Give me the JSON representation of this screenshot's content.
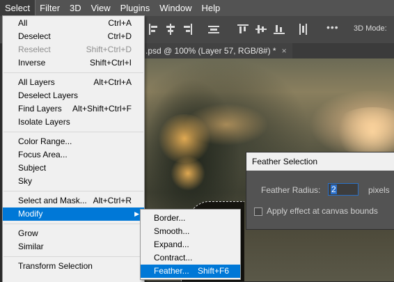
{
  "menubar": {
    "items": [
      "Select",
      "Filter",
      "3D",
      "View",
      "Plugins",
      "Window",
      "Help"
    ],
    "active": "Select"
  },
  "options_bar": {
    "mode_label": "3D Mode:",
    "more_label": "•••"
  },
  "document_tab": {
    "title": ".psd @ 100% (Layer 57, RGB/8#) *",
    "close_glyph": "×"
  },
  "select_menu": {
    "groups": [
      [
        {
          "label": "All",
          "shortcut": "Ctrl+A"
        },
        {
          "label": "Deselect",
          "shortcut": "Ctrl+D"
        },
        {
          "label": "Reselect",
          "shortcut": "Shift+Ctrl+D",
          "disabled": true
        },
        {
          "label": "Inverse",
          "shortcut": "Shift+Ctrl+I"
        }
      ],
      [
        {
          "label": "All Layers",
          "shortcut": "Alt+Ctrl+A"
        },
        {
          "label": "Deselect Layers",
          "shortcut": ""
        },
        {
          "label": "Find Layers",
          "shortcut": "Alt+Shift+Ctrl+F"
        },
        {
          "label": "Isolate Layers",
          "shortcut": ""
        }
      ],
      [
        {
          "label": "Color Range...",
          "shortcut": ""
        },
        {
          "label": "Focus Area...",
          "shortcut": ""
        },
        {
          "label": "Subject",
          "shortcut": ""
        },
        {
          "label": "Sky",
          "shortcut": ""
        }
      ],
      [
        {
          "label": "Select and Mask...",
          "shortcut": "Alt+Ctrl+R"
        },
        {
          "label": "Modify",
          "shortcut": "",
          "submenu": true,
          "highlighted": true
        }
      ],
      [
        {
          "label": "Grow",
          "shortcut": ""
        },
        {
          "label": "Similar",
          "shortcut": ""
        }
      ],
      [
        {
          "label": "Transform Selection",
          "shortcut": ""
        }
      ]
    ]
  },
  "modify_submenu": {
    "items": [
      {
        "label": "Border...",
        "shortcut": ""
      },
      {
        "label": "Smooth...",
        "shortcut": ""
      },
      {
        "label": "Expand...",
        "shortcut": ""
      },
      {
        "label": "Contract...",
        "shortcut": ""
      },
      {
        "label": "Feather...",
        "shortcut": "Shift+F6",
        "highlighted": true
      }
    ]
  },
  "feather_dialog": {
    "title": "Feather Selection",
    "radius_label": "Feather Radius:",
    "radius_value": "2",
    "units": "pixels",
    "checkbox_label": "Apply effect at canvas bounds",
    "checkbox_checked": false
  },
  "colors": {
    "menu_highlight": "#0078d7",
    "menu_background": "#f0f0f0",
    "app_chrome": "#535353"
  }
}
